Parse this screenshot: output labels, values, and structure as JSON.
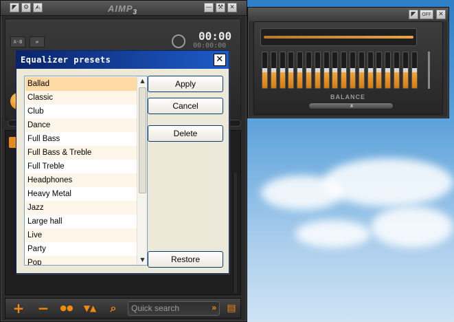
{
  "main_window": {
    "logo": "AIMP",
    "logo_version": "3",
    "titlebar_buttons": [
      "◤",
      "⚙",
      "⮙",
      "—",
      "⚒",
      "✕"
    ],
    "time_main": "00:00",
    "time_sub": "00:00:00",
    "mini_buttons": [
      "A-B",
      "⇄"
    ],
    "search": {
      "placeholder": "Quick search"
    },
    "toolbar": {
      "add": "+",
      "remove": "−",
      "sort": "●●",
      "move": "▼▲",
      "find": "⌕",
      "search_go": "»",
      "file": "▤"
    }
  },
  "eq_window": {
    "toggle_label": "OFF",
    "balance_label": "BALANCE",
    "balance_knob": "x",
    "band_count": 18
  },
  "dialog": {
    "title": "Equalizer presets",
    "close_glyph": "✕",
    "presets": [
      "Ballad",
      "Classic",
      "Club",
      "Dance",
      "Full Bass",
      "Full Bass & Treble",
      "Full Treble",
      "Headphones",
      "Heavy Metal",
      "Jazz",
      "Large hall",
      "Live",
      "Party",
      "Pop"
    ],
    "selected_index": 0,
    "buttons": {
      "apply": "Apply",
      "cancel": "Cancel",
      "delete": "Delete",
      "restore": "Restore"
    }
  },
  "colors": {
    "accent_orange": "#f08a10",
    "selection_bg": "#fdd9a4",
    "alt_row_bg": "#fdf6e8",
    "dialog_title": "#0a246a"
  }
}
